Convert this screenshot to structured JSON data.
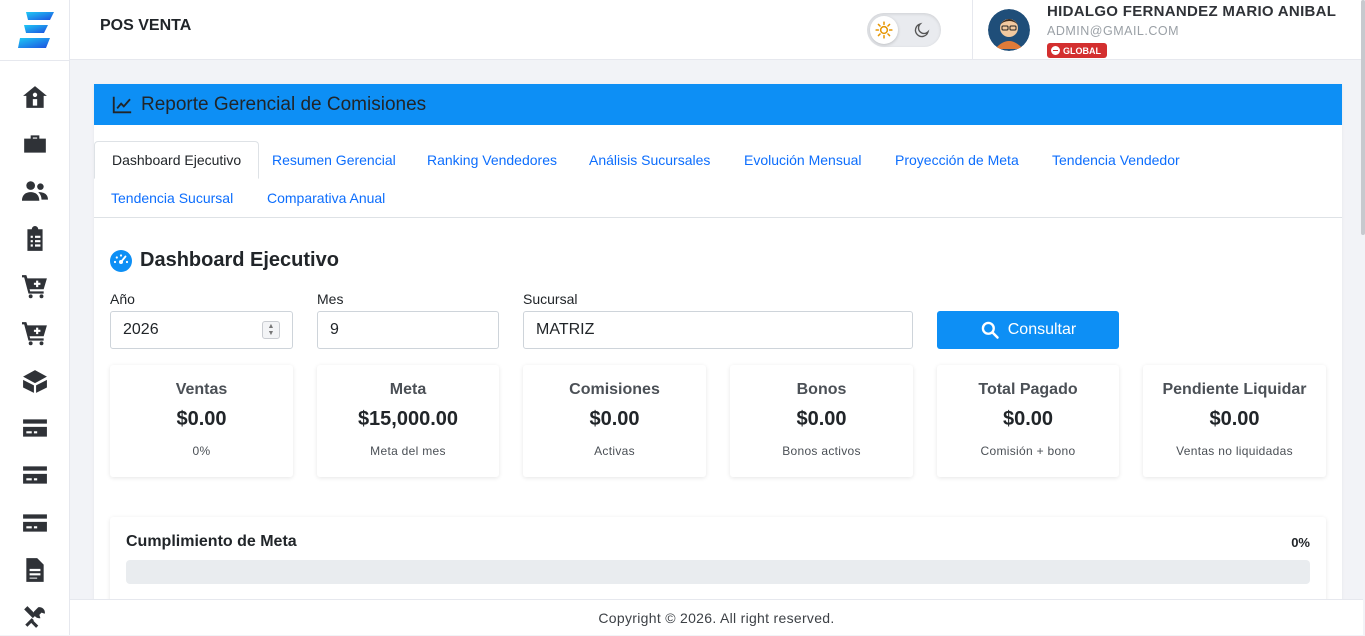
{
  "app": {
    "title": "POS VENTA"
  },
  "theme": {
    "light_icon": "sun-icon",
    "dark_icon": "moon-icon",
    "active": "light"
  },
  "user": {
    "name": "HIDALGO FERNANDEZ MARIO ANIBAL",
    "email": "ADMIN@GMAIL.COM",
    "badge": "GLOBAL"
  },
  "sidebar": {
    "items": [
      {
        "icon": "home-icon"
      },
      {
        "icon": "briefcase-icon"
      },
      {
        "icon": "users-icon"
      },
      {
        "icon": "clipboard-list-icon"
      },
      {
        "icon": "cart-plus-icon"
      },
      {
        "icon": "cart-plus-icon"
      },
      {
        "icon": "box-open-icon"
      },
      {
        "icon": "credit-card-icon"
      },
      {
        "icon": "credit-card-icon"
      },
      {
        "icon": "credit-card-icon"
      },
      {
        "icon": "file-alt-icon"
      },
      {
        "icon": "tools-icon"
      }
    ]
  },
  "report": {
    "title": "Reporte Gerencial de Comisiones"
  },
  "tabs": [
    {
      "label": "Dashboard Ejecutivo",
      "active": true
    },
    {
      "label": "Resumen Gerencial"
    },
    {
      "label": "Ranking Vendedores"
    },
    {
      "label": "Análisis Sucursales"
    },
    {
      "label": "Evolución Mensual"
    },
    {
      "label": "Proyección de Meta"
    },
    {
      "label": "Tendencia Vendedor"
    },
    {
      "label": "Tendencia Sucursal"
    },
    {
      "label": "Comparativa Anual"
    }
  ],
  "dashboard": {
    "title": "Dashboard Ejecutivo",
    "filters": {
      "year_label": "Año",
      "year_value": "2026",
      "month_label": "Mes",
      "month_value": "9",
      "branch_label": "Sucursal",
      "branch_value": "MATRIZ"
    },
    "consult_button": "Consultar"
  },
  "stats": [
    {
      "label": "Ventas",
      "value": "$0.00",
      "sub": "0%"
    },
    {
      "label": "Meta",
      "value": "$15,000.00",
      "sub": "Meta del mes"
    },
    {
      "label": "Comisiones",
      "value": "$0.00",
      "sub": "Activas"
    },
    {
      "label": "Bonos",
      "value": "$0.00",
      "sub": "Bonos activos"
    },
    {
      "label": "Total Pagado",
      "value": "$0.00",
      "sub": "Comisión + bono"
    },
    {
      "label": "Pendiente Liquidar",
      "value": "$0.00",
      "sub": "Ventas no liquidadas"
    }
  ],
  "progress": {
    "title": "Cumplimiento de Meta",
    "percent_label": "0%",
    "fraction": 0
  },
  "footer": {
    "text": "Copyright © 2026. All right reserved."
  },
  "colors": {
    "accent": "#0d8ff5",
    "badge": "#d32f2f",
    "link": "#0d6efd"
  }
}
